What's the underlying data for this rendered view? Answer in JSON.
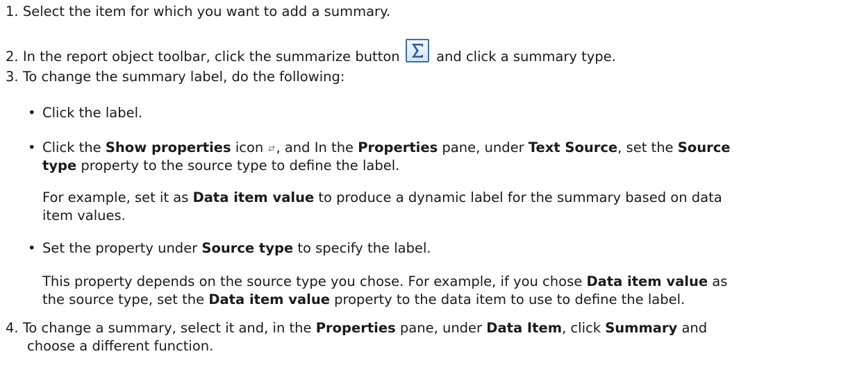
{
  "steps": {
    "s1": {
      "num": "1.",
      "text": "Select the item for which you want to add a summary."
    },
    "s2": {
      "num": "2.",
      "pre": "In the report object toolbar, click the summarize button",
      "post": "and click a summary type."
    },
    "s3": {
      "num": "3.",
      "text": "To change the summary label, do the following:",
      "b1": "Click the label.",
      "b2": {
        "t1": "Click the ",
        "k1": "Show properties",
        "t2": " icon ",
        "t3": ", and In the ",
        "k2": "Properties",
        "t4": " pane, under ",
        "k3": "Text Source",
        "t5": ", set the ",
        "k4": "Source",
        "k5": "type",
        "t6": " property to the source type to define the label."
      },
      "p1": {
        "t1": "For example, set it as ",
        "k1": "Data item value",
        "t2": " to produce a dynamic label for the summary based on data",
        "t3": "item values."
      },
      "b3": {
        "t1": "Set the property under ",
        "k1": "Source type",
        "t2": " to specify the label."
      },
      "p2": {
        "t1": "This property depends on the source type you chose. For example, if you chose ",
        "k1": "Data item value",
        "t2": " as",
        "t3": "the source type, set the ",
        "k2": "Data item value",
        "t4": " property to the data item to use to define the label."
      }
    },
    "s4": {
      "num": "4.",
      "t1": "To change a summary, select it and, in the ",
      "k1": "Properties",
      "t2": " pane, under ",
      "k2": "Data Item",
      "t3": ", click ",
      "k3": "Summary",
      "t4": " and",
      "t5": "choose a different function."
    }
  },
  "icons": {
    "summarize": "sigma-icon",
    "properties": "show-properties-icon"
  },
  "colors": {
    "icon_border": "#2b73b8",
    "text": "#1a1a1a"
  }
}
